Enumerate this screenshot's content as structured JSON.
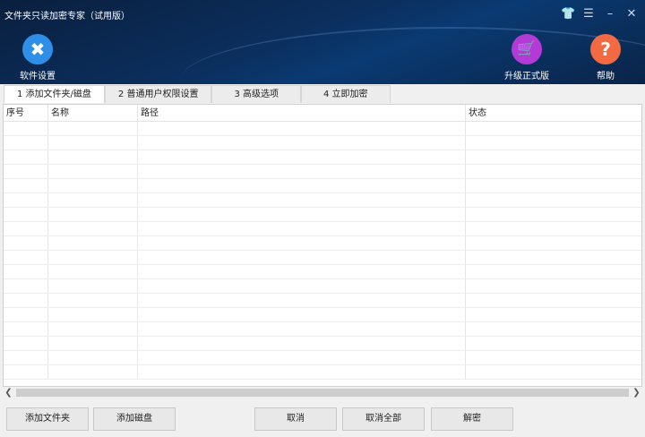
{
  "window": {
    "title": "文件夹只读加密专家（试用版）",
    "controls": [
      "skin",
      "menu",
      "minimize",
      "close"
    ]
  },
  "toolbar": {
    "settings": "软件设置",
    "upgrade": "升级正式版",
    "help": "帮助",
    "colors": {
      "settings": "#2f8fe8",
      "upgrade": "#b33ad6",
      "help": "#f26a42"
    }
  },
  "tabs": [
    "1 添加文件夹/磁盘",
    "2 普通用户权限设置",
    "3 高级选项",
    "4 立即加密"
  ],
  "table": {
    "columns": [
      "序号",
      "名称",
      "路径",
      "状态"
    ],
    "rows": []
  },
  "buttons": {
    "add_folder": "添加文件夹",
    "add_disk": "添加磁盘",
    "cancel": "取消",
    "cancel_all": "取消全部",
    "decrypt": "解密"
  }
}
